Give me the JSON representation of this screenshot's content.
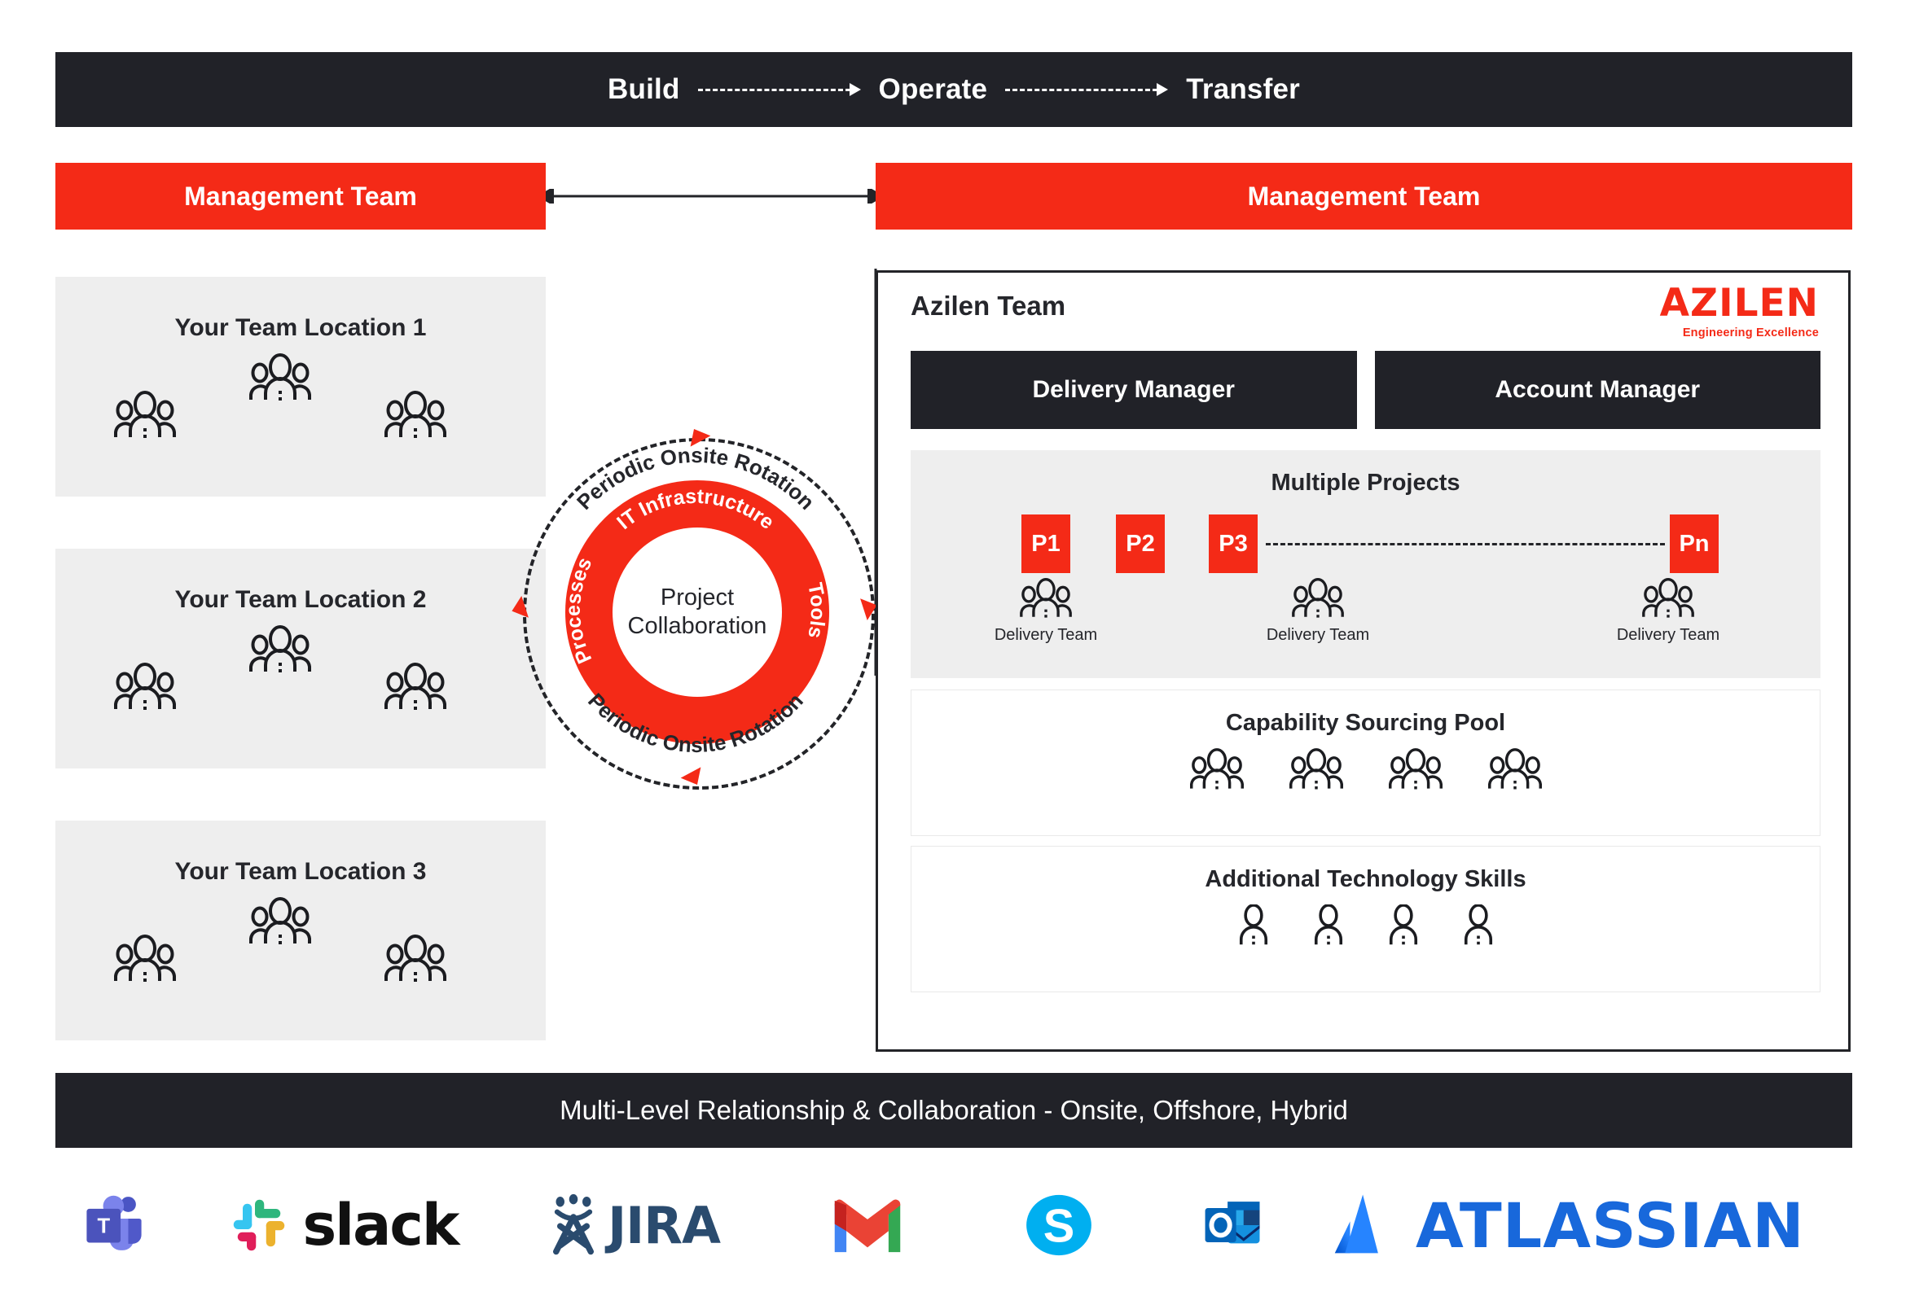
{
  "top_bar": {
    "phases": [
      "Build",
      "Operate",
      "Transfer"
    ],
    "arrow_icon": "dashed-arrow-right-icon",
    "background": "#212228"
  },
  "management": {
    "left_label": "Management Team",
    "right_label": "Management Team",
    "accent": "#F42A17",
    "connector_icon": "double-headed-arrow-icon"
  },
  "client_teams": {
    "boxes": [
      {
        "title": "Your Team Location 1",
        "group_icons": 3
      },
      {
        "title": "Your Team Location 2",
        "group_icons": 3
      },
      {
        "title": "Your Team Location 3",
        "group_icons": 3
      }
    ],
    "background": "#eeeeee"
  },
  "collaboration_circle": {
    "center_line1": "Project",
    "center_line2": "Collaboration",
    "outer_top": "Periodic Onsite Rotation",
    "outer_bottom": "Periodic Onsite Rotation",
    "ring_top": "IT Infrastructure",
    "ring_left": "Processes",
    "ring_right": "Tools",
    "ring_color": "#F42A17",
    "arrow_icon": "red-triangle-arrow-icon",
    "arrow_count": 4
  },
  "azilen": {
    "title": "Azilen Team",
    "logo_word": "AZILEN",
    "logo_tagline": "Engineering Excellence",
    "logo_color": "#F42A17",
    "managers": [
      "Delivery Manager",
      "Account Manager"
    ],
    "projects": {
      "heading": "Multiple Projects",
      "boxes": [
        "P1",
        "P2",
        "P3",
        "Pn"
      ],
      "dash_connector": "dashed-line-icon",
      "delivery_team_label": "Delivery Team",
      "delivery_team_count": 3,
      "background": "#eeeeee"
    },
    "pool": {
      "heading": "Capability Sourcing Pool",
      "group_icons": 4
    },
    "skills": {
      "heading": "Additional Technology Skills",
      "person_icons": 4
    }
  },
  "bottom_bar": {
    "text": "Multi-Level Relationship & Collaboration - Onsite, Offshore, Hybrid",
    "background": "#212228"
  },
  "tool_logos": [
    {
      "name": "microsoft-teams",
      "label": ""
    },
    {
      "name": "slack",
      "label": "slack"
    },
    {
      "name": "jira",
      "label": "JIRA"
    },
    {
      "name": "gmail",
      "label": ""
    },
    {
      "name": "skype",
      "label": ""
    },
    {
      "name": "outlook",
      "label": ""
    },
    {
      "name": "atlassian",
      "label": "ATLASSIAN"
    }
  ]
}
